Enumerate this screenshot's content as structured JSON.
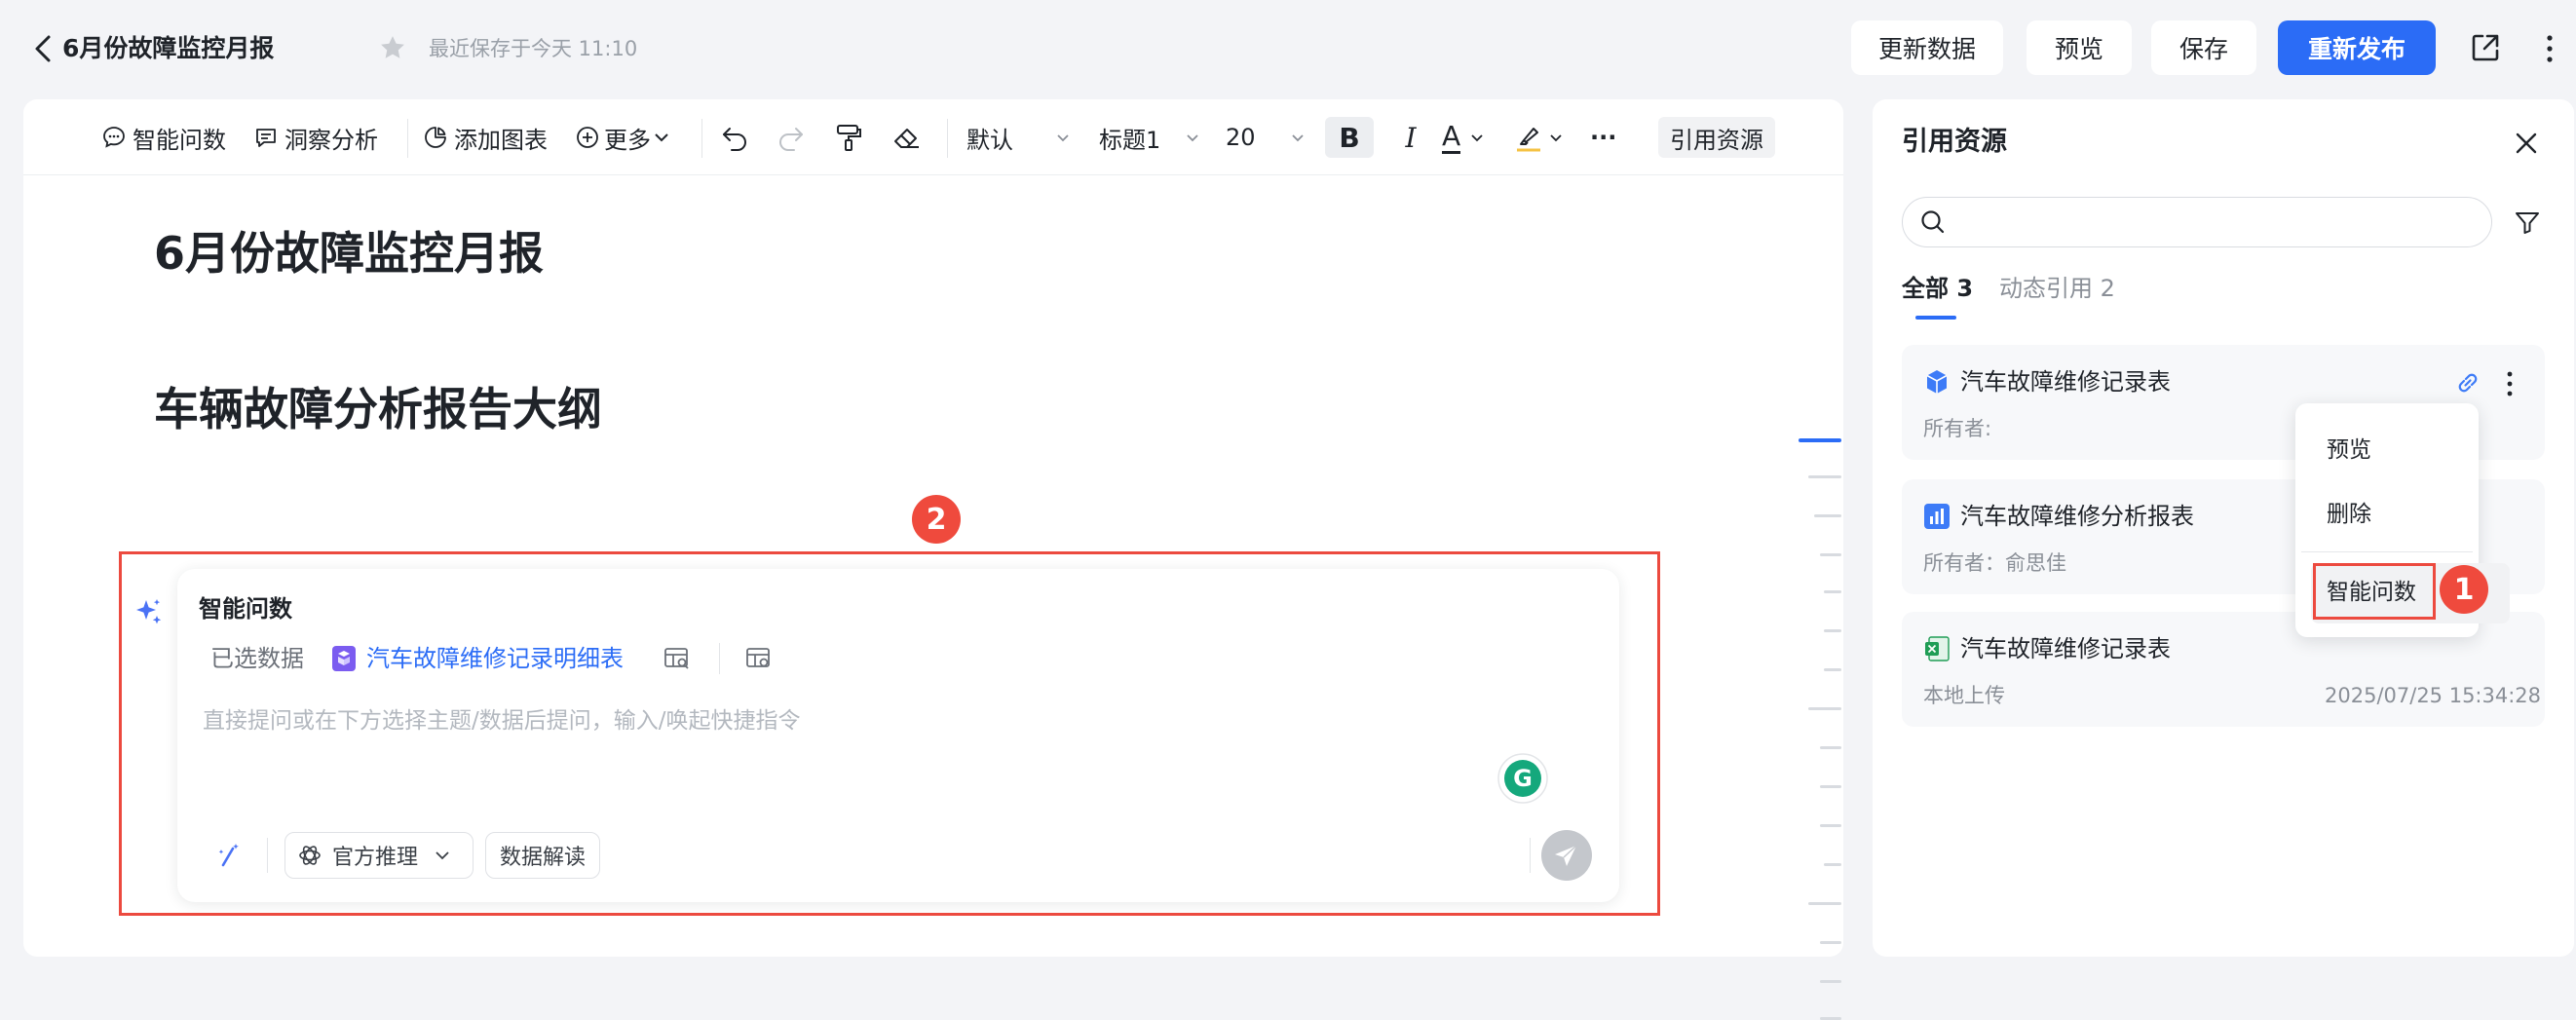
{
  "header": {
    "doc_title": "6月份故障监控月报",
    "save_status": "最近保存于今天 11:10",
    "buttons": {
      "refresh": "更新数据",
      "preview": "预览",
      "save": "保存",
      "publish": "重新发布"
    },
    "accent": "#2b6cf6"
  },
  "toolbar": {
    "smart_query": "智能问数",
    "insight": "洞察分析",
    "add_chart": "添加图表",
    "more": "更多",
    "font_default": "默认",
    "heading": "标题1",
    "font_size": "20",
    "bold": "B",
    "italic": "I",
    "text_color": "A",
    "cite": "引用资源",
    "ellipsis": "···"
  },
  "document": {
    "title": "6月份故障监控月报",
    "outline_heading": "车辆故障分析报告大纲"
  },
  "ai_panel": {
    "title": "智能问数",
    "selected_label": "已选数据",
    "dataset": "汽车故障维修记录明细表",
    "placeholder": "直接提问或在下方选择主题/数据后提问，输入/唤起快捷指令",
    "model": "官方推理",
    "interpret": "数据解读",
    "grammarly_letter": "G"
  },
  "annotations": {
    "one": "1",
    "two": "2",
    "color": "#ec4a3f"
  },
  "resource_panel": {
    "title": "引用资源",
    "search_placeholder": "",
    "tabs": [
      {
        "label": "全部 3",
        "active": true
      },
      {
        "label": "动态引用 2",
        "active": false
      }
    ],
    "items": [
      {
        "name": "汽车故障维修记录表",
        "sub": "所有者:",
        "date": "",
        "icon": "cube-icon"
      },
      {
        "name": "汽车故障维修分析报表",
        "sub": "所有者：俞思佳",
        "date": "",
        "icon": "bar-chart-icon"
      },
      {
        "name": "汽车故障维修记录表",
        "sub": "本地上传",
        "date": "2025/07/25 15:34:28",
        "icon": "excel-icon"
      }
    ],
    "menu": {
      "preview": "预览",
      "delete": "删除",
      "smart_query": "智能问数"
    }
  }
}
